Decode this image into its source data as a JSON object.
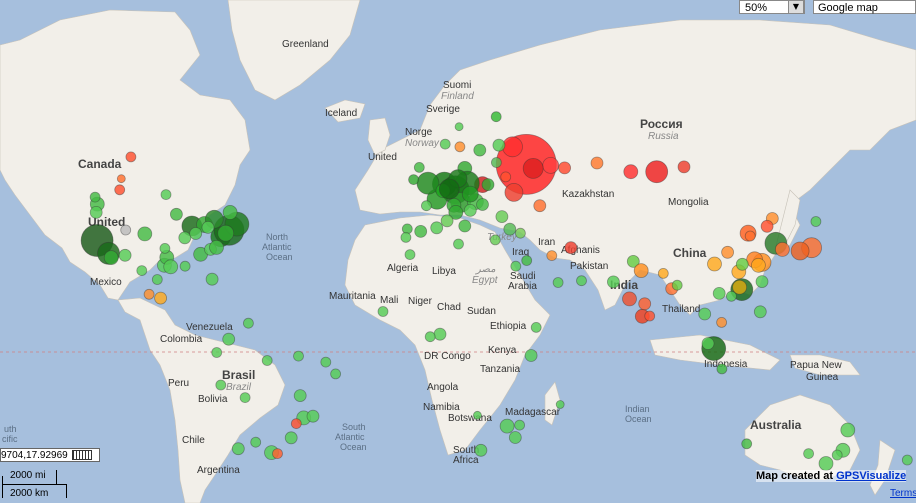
{
  "controls": {
    "zoom_value": "50%",
    "map_type": "Google map",
    "coords": "9704,17.92969"
  },
  "scale": {
    "miles": "2000 mi",
    "km": "2000 km"
  },
  "credit": {
    "prefix": "Map created at ",
    "link": "GPSVisualize"
  },
  "terms": "Terms",
  "labels": {
    "greenland": "Greenland",
    "iceland": "Iceland",
    "canada": "Canada",
    "united": "United",
    "mexico": "Mexico",
    "suomi": "Suomi",
    "finland": "Finland",
    "sverige": "Sverige",
    "norge": "Norge",
    "norway": "Norway",
    "united_kingdom": "United",
    "rossiya": "Россия",
    "russia": "Russia",
    "kazakhstan": "Kazakhstan",
    "mongolia": "Mongolia",
    "china": "China",
    "afghanistan": "Afghanis",
    "pakistan": "Pakistan",
    "india": "India",
    "thailand": "Thailand",
    "indonesia": "Indonesia",
    "papua": "Papua New",
    "guinea": "Guinea",
    "australia": "Australia",
    "north_atlantic": "North",
    "north_atlantic2": "Atlantic",
    "north_atlantic3": "Ocean",
    "south_atlantic": "South",
    "south_atlantic2": "Atlantic",
    "south_atlantic3": "Ocean",
    "indian": "Indian",
    "indian2": "Ocean",
    "pacific1": "outh",
    "pacific2": "acific",
    "pacific3": "cean",
    "algeria": "Algeria",
    "libya": "Libya",
    "egypt": "Egypt",
    "egypt_ar": "مصر",
    "mauritania": "Mauritania",
    "mali": "Mali",
    "niger": "Niger",
    "chad": "Chad",
    "sudan": "Sudan",
    "ethiopia": "Ethiopia",
    "dr_congo": "DR Congo",
    "kenya": "Kenya",
    "tanzania": "Tanzania",
    "angola": "Angola",
    "namibia": "Namibia",
    "botswana": "Botswana",
    "south_africa": "South",
    "south_africa2": "Africa",
    "madagascar": "Madagascar",
    "saudi": "Saudi",
    "arabia": "Arabia",
    "iraq": "Iraq",
    "iran": "Iran",
    "turkey": "Turkey",
    "venezuela": "Venezuela",
    "colombia": "Colombia",
    "peru": "Peru",
    "brasil": "Brasil",
    "brazil": "Brazil",
    "bolivia": "Bolivia",
    "chile": "Chile",
    "argentina": "Argentina",
    "pacific_left1": "uth",
    "pacific_left2": "cific",
    "pacific_left3": "ean"
  },
  "markers": [
    {
      "lon": 35.0,
      "lat": 56.5,
      "r": 30,
      "color": "#ff2020"
    },
    {
      "lon": 30.0,
      "lat": 59.9,
      "r": 10,
      "color": "#ff3030"
    },
    {
      "lon": 44.0,
      "lat": 56.3,
      "r": 8,
      "color": "#ff4040"
    },
    {
      "lon": 37.6,
      "lat": 55.7,
      "r": 10,
      "color": "#dd2020"
    },
    {
      "lon": 82.9,
      "lat": 55.0,
      "r": 11,
      "color": "#ee2020"
    },
    {
      "lon": 61.0,
      "lat": 56.8,
      "r": 6,
      "color": "#ff7a30"
    },
    {
      "lon": 92.9,
      "lat": 56.0,
      "r": 6,
      "color": "#ee4030"
    },
    {
      "lon": 73.4,
      "lat": 55.0,
      "r": 7,
      "color": "#ff3030"
    },
    {
      "lon": 49.1,
      "lat": 55.8,
      "r": 6,
      "color": "#ff4a30"
    },
    {
      "lon": 40.0,
      "lat": 47.2,
      "r": 6,
      "color": "#ff7030"
    },
    {
      "lon": 30.5,
      "lat": 50.4,
      "r": 9,
      "color": "#ee4030"
    },
    {
      "lon": 19.0,
      "lat": 52.2,
      "r": 8,
      "color": "#cc2020"
    },
    {
      "lon": 24.0,
      "lat": 65.0,
      "r": 5,
      "color": "#33bb33"
    },
    {
      "lon": 25.0,
      "lat": 60.2,
      "r": 6,
      "color": "#55cc55"
    },
    {
      "lon": 18.0,
      "lat": 59.3,
      "r": 6,
      "color": "#44bb44"
    },
    {
      "lon": 10.7,
      "lat": 59.9,
      "r": 5,
      "color": "#ff9030"
    },
    {
      "lon": 12.5,
      "lat": 55.7,
      "r": 7,
      "color": "#33aa33"
    },
    {
      "lon": 5.0,
      "lat": 52.3,
      "r": 12,
      "color": "#117711"
    },
    {
      "lon": 9.0,
      "lat": 51.0,
      "r": 14,
      "color": "#0f6a0f"
    },
    {
      "lon": 13.4,
      "lat": 52.5,
      "r": 12,
      "color": "#187a18"
    },
    {
      "lon": 2.3,
      "lat": 48.8,
      "r": 10,
      "color": "#229922"
    },
    {
      "lon": -1.0,
      "lat": 52.5,
      "r": 11,
      "color": "#1f8a1f"
    },
    {
      "lon": -6.3,
      "lat": 53.3,
      "r": 5,
      "color": "#33aa33"
    },
    {
      "lon": 11.0,
      "lat": 48.0,
      "r": 10,
      "color": "#2a9a2a"
    },
    {
      "lon": 16.4,
      "lat": 48.2,
      "r": 8,
      "color": "#44bb44"
    },
    {
      "lon": 8.5,
      "lat": 47.3,
      "r": 7,
      "color": "#33aa33"
    },
    {
      "lon": 4.5,
      "lat": 50.8,
      "r": 7,
      "color": "#22aa22"
    },
    {
      "lon": -3.7,
      "lat": 40.4,
      "r": 6,
      "color": "#44bb44"
    },
    {
      "lon": 2.2,
      "lat": 41.4,
      "r": 6,
      "color": "#55cc55"
    },
    {
      "lon": 12.5,
      "lat": 41.9,
      "r": 6,
      "color": "#44bb44"
    },
    {
      "lon": 9.2,
      "lat": 45.5,
      "r": 7,
      "color": "#33aa33"
    },
    {
      "lon": 14.5,
      "lat": 46.0,
      "r": 6,
      "color": "#55cc55"
    },
    {
      "lon": 19.0,
      "lat": 47.5,
      "r": 6,
      "color": "#44bb44"
    },
    {
      "lon": 26.1,
      "lat": 44.4,
      "r": 6,
      "color": "#66cc55"
    },
    {
      "lon": 23.7,
      "lat": 38.0,
      "r": 5,
      "color": "#66cc55"
    },
    {
      "lon": 29.0,
      "lat": 41.0,
      "r": 6,
      "color": "#55bb55"
    },
    {
      "lon": 32.9,
      "lat": 39.9,
      "r": 5,
      "color": "#77cc55"
    },
    {
      "lon": 21.0,
      "lat": 52.2,
      "r": 6,
      "color": "#33aa33"
    },
    {
      "lon": 24.1,
      "lat": 56.9,
      "r": 5,
      "color": "#55bb55"
    },
    {
      "lon": 14.5,
      "lat": 50.0,
      "r": 8,
      "color": "#229922"
    },
    {
      "lon": -8.6,
      "lat": 41.1,
      "r": 5,
      "color": "#44bb44"
    },
    {
      "lon": -9.1,
      "lat": 38.7,
      "r": 5,
      "color": "#55cc55"
    },
    {
      "lon": 6.0,
      "lat": 43.3,
      "r": 6,
      "color": "#66cc55"
    },
    {
      "lon": -1.6,
      "lat": 47.2,
      "r": 5,
      "color": "#55cc55"
    },
    {
      "lon": 10.0,
      "lat": 53.5,
      "r": 9,
      "color": "#1a7a1a"
    },
    {
      "lon": 6.8,
      "lat": 51.2,
      "r": 10,
      "color": "#136a13"
    },
    {
      "lon": -4.2,
      "lat": 55.9,
      "r": 5,
      "color": "#44bb44"
    },
    {
      "lon": 5.3,
      "lat": 60.4,
      "r": 5,
      "color": "#55cc55"
    },
    {
      "lon": 10.4,
      "lat": 63.4,
      "r": 4,
      "color": "#55cc55"
    },
    {
      "lon": 27.5,
      "lat": 53.9,
      "r": 5,
      "color": "#ff5030"
    },
    {
      "lon": 35.2,
      "lat": 31.8,
      "r": 5,
      "color": "#44bb44"
    },
    {
      "lon": 44.4,
      "lat": 33.3,
      "r": 5,
      "color": "#ff9030"
    },
    {
      "lon": 51.4,
      "lat": 35.7,
      "r": 6,
      "color": "#ee4030"
    },
    {
      "lon": 46.7,
      "lat": 24.7,
      "r": 5,
      "color": "#55cc55"
    },
    {
      "lon": 55.3,
      "lat": 25.3,
      "r": 5,
      "color": "#55cc55"
    },
    {
      "lon": 67.0,
      "lat": 24.9,
      "r": 6,
      "color": "#55cc55"
    },
    {
      "lon": 74.3,
      "lat": 31.5,
      "r": 6,
      "color": "#66cc44"
    },
    {
      "lon": 77.2,
      "lat": 28.6,
      "r": 7,
      "color": "#ff9020"
    },
    {
      "lon": 72.9,
      "lat": 19.1,
      "r": 7,
      "color": "#ee5030"
    },
    {
      "lon": 77.6,
      "lat": 13.0,
      "r": 7,
      "color": "#ee4020"
    },
    {
      "lon": 80.3,
      "lat": 13.1,
      "r": 5,
      "color": "#ff5030"
    },
    {
      "lon": 88.4,
      "lat": 22.6,
      "r": 6,
      "color": "#ff7030"
    },
    {
      "lon": 78.5,
      "lat": 17.4,
      "r": 6,
      "color": "#ff6030"
    },
    {
      "lon": 85.3,
      "lat": 27.7,
      "r": 5,
      "color": "#ffaa20"
    },
    {
      "lon": 90.4,
      "lat": 23.8,
      "r": 5,
      "color": "#66cc44"
    },
    {
      "lon": 100.5,
      "lat": 13.8,
      "r": 6,
      "color": "#55cc55"
    },
    {
      "lon": 103.8,
      "lat": 1.3,
      "r": 12,
      "color": "#116611"
    },
    {
      "lon": 106.8,
      "lat": -6.2,
      "r": 5,
      "color": "#44bb44"
    },
    {
      "lon": 101.7,
      "lat": 3.1,
      "r": 6,
      "color": "#55cc55"
    },
    {
      "lon": 106.7,
      "lat": 10.8,
      "r": 5,
      "color": "#ff9030"
    },
    {
      "lon": 105.8,
      "lat": 21.0,
      "r": 6,
      "color": "#55cc55"
    },
    {
      "lon": 114.1,
      "lat": 22.3,
      "r": 11,
      "color": "#1a6a1a"
    },
    {
      "lon": 113.3,
      "lat": 23.1,
      "r": 7,
      "color": "#ddaa10"
    },
    {
      "lon": 121.5,
      "lat": 31.2,
      "r": 9,
      "color": "#ff9020"
    },
    {
      "lon": 116.4,
      "lat": 39.9,
      "r": 8,
      "color": "#ff6020"
    },
    {
      "lon": 117.2,
      "lat": 39.1,
      "r": 5,
      "color": "#ff7030"
    },
    {
      "lon": 104.1,
      "lat": 30.7,
      "r": 7,
      "color": "#ffaa20"
    },
    {
      "lon": 108.9,
      "lat": 34.3,
      "r": 6,
      "color": "#ff9030"
    },
    {
      "lon": 126.6,
      "lat": 37.0,
      "r": 11,
      "color": "#2a7a2a"
    },
    {
      "lon": 129.0,
      "lat": 35.2,
      "r": 7,
      "color": "#ff7030"
    },
    {
      "lon": 121.5,
      "lat": 25.0,
      "r": 6,
      "color": "#55cc55"
    },
    {
      "lon": 139.7,
      "lat": 35.7,
      "r": 10,
      "color": "#ff7030"
    },
    {
      "lon": 135.5,
      "lat": 34.7,
      "r": 9,
      "color": "#ee6020"
    },
    {
      "lon": 141.3,
      "lat": 43.1,
      "r": 5,
      "color": "#55cc55"
    },
    {
      "lon": 125.3,
      "lat": 43.9,
      "r": 6,
      "color": "#ff9030"
    },
    {
      "lon": 123.4,
      "lat": 41.8,
      "r": 6,
      "color": "#ff5030"
    },
    {
      "lon": 120.9,
      "lat": 14.6,
      "r": 6,
      "color": "#55cc55"
    },
    {
      "lon": 110.3,
      "lat": 20.0,
      "r": 5,
      "color": "#55cc55"
    },
    {
      "lon": 113.0,
      "lat": 28.2,
      "r": 7,
      "color": "#ffaa20"
    },
    {
      "lon": 118.8,
      "lat": 32.0,
      "r": 8,
      "color": "#ff8020"
    },
    {
      "lon": 120.2,
      "lat": 30.3,
      "r": 7,
      "color": "#ffaa20"
    },
    {
      "lon": 114.3,
      "lat": 30.6,
      "r": 6,
      "color": "#66cc44"
    },
    {
      "lon": 151.2,
      "lat": -33.9,
      "r": 7,
      "color": "#55cc55"
    },
    {
      "lon": 145.0,
      "lat": -37.8,
      "r": 7,
      "color": "#55cc55"
    },
    {
      "lon": 153.0,
      "lat": -27.5,
      "r": 7,
      "color": "#55cc55"
    },
    {
      "lon": 115.9,
      "lat": -31.9,
      "r": 5,
      "color": "#44bb44"
    },
    {
      "lon": 138.6,
      "lat": -34.9,
      "r": 5,
      "color": "#55cc55"
    },
    {
      "lon": 174.8,
      "lat": -36.8,
      "r": 5,
      "color": "#55cc55"
    },
    {
      "lon": 149.1,
      "lat": -35.3,
      "r": 5,
      "color": "#55cc55"
    },
    {
      "lon": -122.4,
      "lat": 37.8,
      "r": 16,
      "color": "#1a5a1a"
    },
    {
      "lon": -118.2,
      "lat": 34.0,
      "r": 11,
      "color": "#1a6a1a"
    },
    {
      "lon": -117.2,
      "lat": 32.7,
      "r": 7,
      "color": "#33aa33"
    },
    {
      "lon": -122.3,
      "lat": 47.6,
      "r": 7,
      "color": "#44bb44"
    },
    {
      "lon": -122.7,
      "lat": 45.5,
      "r": 6,
      "color": "#55cc55"
    },
    {
      "lon": -123.1,
      "lat": 49.3,
      "r": 5,
      "color": "#44bb44"
    },
    {
      "lon": -114.1,
      "lat": 51.0,
      "r": 5,
      "color": "#ff5030"
    },
    {
      "lon": -113.5,
      "lat": 53.5,
      "r": 4,
      "color": "#ff7030"
    },
    {
      "lon": -104.9,
      "lat": 39.7,
      "r": 7,
      "color": "#44bb44"
    },
    {
      "lon": -112.1,
      "lat": 33.4,
      "r": 6,
      "color": "#55cc55"
    },
    {
      "lon": -97.7,
      "lat": 30.3,
      "r": 7,
      "color": "#55cc55"
    },
    {
      "lon": -96.8,
      "lat": 32.8,
      "r": 7,
      "color": "#44bb44"
    },
    {
      "lon": -95.4,
      "lat": 29.8,
      "r": 7,
      "color": "#55cc55"
    },
    {
      "lon": -87.6,
      "lat": 41.9,
      "r": 10,
      "color": "#1a6a1a"
    },
    {
      "lon": -83.0,
      "lat": 42.3,
      "r": 8,
      "color": "#33aa33"
    },
    {
      "lon": -84.4,
      "lat": 33.7,
      "r": 7,
      "color": "#44bb44"
    },
    {
      "lon": -80.2,
      "lat": 25.8,
      "r": 6,
      "color": "#55cc55"
    },
    {
      "lon": -77.0,
      "lat": 38.9,
      "r": 10,
      "color": "#1a7a1a"
    },
    {
      "lon": -74.0,
      "lat": 40.7,
      "r": 15,
      "color": "#1a6a1a"
    },
    {
      "lon": -71.1,
      "lat": 42.4,
      "r": 12,
      "color": "#1f7a1f"
    },
    {
      "lon": -79.4,
      "lat": 43.7,
      "r": 9,
      "color": "#2a8a2a"
    },
    {
      "lon": -73.6,
      "lat": 45.5,
      "r": 7,
      "color": "#44bb44"
    },
    {
      "lon": -75.2,
      "lat": 39.9,
      "r": 8,
      "color": "#33aa33"
    },
    {
      "lon": -81.7,
      "lat": 41.5,
      "r": 6,
      "color": "#55cc55"
    },
    {
      "lon": -90.2,
      "lat": 38.6,
      "r": 6,
      "color": "#55cc55"
    },
    {
      "lon": -93.3,
      "lat": 45.0,
      "r": 6,
      "color": "#44bb44"
    },
    {
      "lon": -86.2,
      "lat": 39.8,
      "r": 6,
      "color": "#55cc55"
    },
    {
      "lon": -80.8,
      "lat": 35.2,
      "r": 6,
      "color": "#55cc55"
    },
    {
      "lon": -78.6,
      "lat": 35.8,
      "r": 7,
      "color": "#44bb44"
    },
    {
      "lon": -111.9,
      "lat": 40.8,
      "r": 5,
      "color": "#bbbbbb"
    },
    {
      "lon": -97.5,
      "lat": 35.5,
      "r": 5,
      "color": "#55cc55"
    },
    {
      "lon": -90.1,
      "lat": 30.0,
      "r": 5,
      "color": "#55cc55"
    },
    {
      "lon": -99.1,
      "lat": 19.4,
      "r": 6,
      "color": "#ffaa20"
    },
    {
      "lon": -103.3,
      "lat": 20.7,
      "r": 5,
      "color": "#ff9030"
    },
    {
      "lon": -100.3,
      "lat": 25.7,
      "r": 5,
      "color": "#55cc55"
    },
    {
      "lon": -106.0,
      "lat": 28.6,
      "r": 5,
      "color": "#55cc55"
    },
    {
      "lon": -110.0,
      "lat": 58.0,
      "r": 5,
      "color": "#ff5030"
    },
    {
      "lon": -97.1,
      "lat": 49.9,
      "r": 5,
      "color": "#55cc55"
    },
    {
      "lon": -66.9,
      "lat": 10.5,
      "r": 5,
      "color": "#55cc55"
    },
    {
      "lon": -74.1,
      "lat": 4.7,
      "r": 6,
      "color": "#55cc55"
    },
    {
      "lon": -77.0,
      "lat": -12.0,
      "r": 5,
      "color": "#55cc55"
    },
    {
      "lon": -78.5,
      "lat": -0.2,
      "r": 5,
      "color": "#55cc55"
    },
    {
      "lon": -46.6,
      "lat": -23.5,
      "r": 7,
      "color": "#55cc55"
    },
    {
      "lon": -43.2,
      "lat": -22.9,
      "r": 6,
      "color": "#55cc55"
    },
    {
      "lon": -47.9,
      "lat": -15.8,
      "r": 6,
      "color": "#55cc55"
    },
    {
      "lon": -38.5,
      "lat": -3.7,
      "r": 5,
      "color": "#55cc55"
    },
    {
      "lon": -34.9,
      "lat": -8.0,
      "r": 5,
      "color": "#55cc55"
    },
    {
      "lon": -51.2,
      "lat": -30.0,
      "r": 6,
      "color": "#55cc55"
    },
    {
      "lon": -49.3,
      "lat": -25.4,
      "r": 5,
      "color": "#ff5030"
    },
    {
      "lon": -58.4,
      "lat": -34.6,
      "r": 7,
      "color": "#55cc55"
    },
    {
      "lon": -70.6,
      "lat": -33.4,
      "r": 6,
      "color": "#55cc55"
    },
    {
      "lon": -56.2,
      "lat": -34.9,
      "r": 5,
      "color": "#ff6030"
    },
    {
      "lon": -64.2,
      "lat": -31.4,
      "r": 5,
      "color": "#55cc55"
    },
    {
      "lon": -68.1,
      "lat": -16.5,
      "r": 5,
      "color": "#55cc55"
    },
    {
      "lon": -60.0,
      "lat": -3.1,
      "r": 5,
      "color": "#55cc55"
    },
    {
      "lon": -48.5,
      "lat": -1.5,
      "r": 5,
      "color": "#55cc55"
    },
    {
      "lon": 31.2,
      "lat": 30.0,
      "r": 5,
      "color": "#55cc55"
    },
    {
      "lon": -7.6,
      "lat": 33.6,
      "r": 5,
      "color": "#55cc55"
    },
    {
      "lon": 10.2,
      "lat": 36.8,
      "r": 5,
      "color": "#55cc55"
    },
    {
      "lon": 3.4,
      "lat": 6.5,
      "r": 6,
      "color": "#55cc55"
    },
    {
      "lon": -0.2,
      "lat": 5.6,
      "r": 5,
      "color": "#55cc55"
    },
    {
      "lon": 36.8,
      "lat": -1.3,
      "r": 6,
      "color": "#55cc55"
    },
    {
      "lon": 38.7,
      "lat": 9.0,
      "r": 5,
      "color": "#55cc55"
    },
    {
      "lon": 28.0,
      "lat": -26.2,
      "r": 7,
      "color": "#55cc55"
    },
    {
      "lon": 18.4,
      "lat": -33.9,
      "r": 6,
      "color": "#55cc55"
    },
    {
      "lon": 31.0,
      "lat": -29.9,
      "r": 6,
      "color": "#55cc55"
    },
    {
      "lon": 32.6,
      "lat": -25.9,
      "r": 5,
      "color": "#55cc55"
    },
    {
      "lon": 47.5,
      "lat": -18.9,
      "r": 4,
      "color": "#55cc55"
    },
    {
      "lon": 17.1,
      "lat": -22.6,
      "r": 4,
      "color": "#55cc55"
    },
    {
      "lon": -17.5,
      "lat": 14.7,
      "r": 5,
      "color": "#55cc55"
    }
  ]
}
